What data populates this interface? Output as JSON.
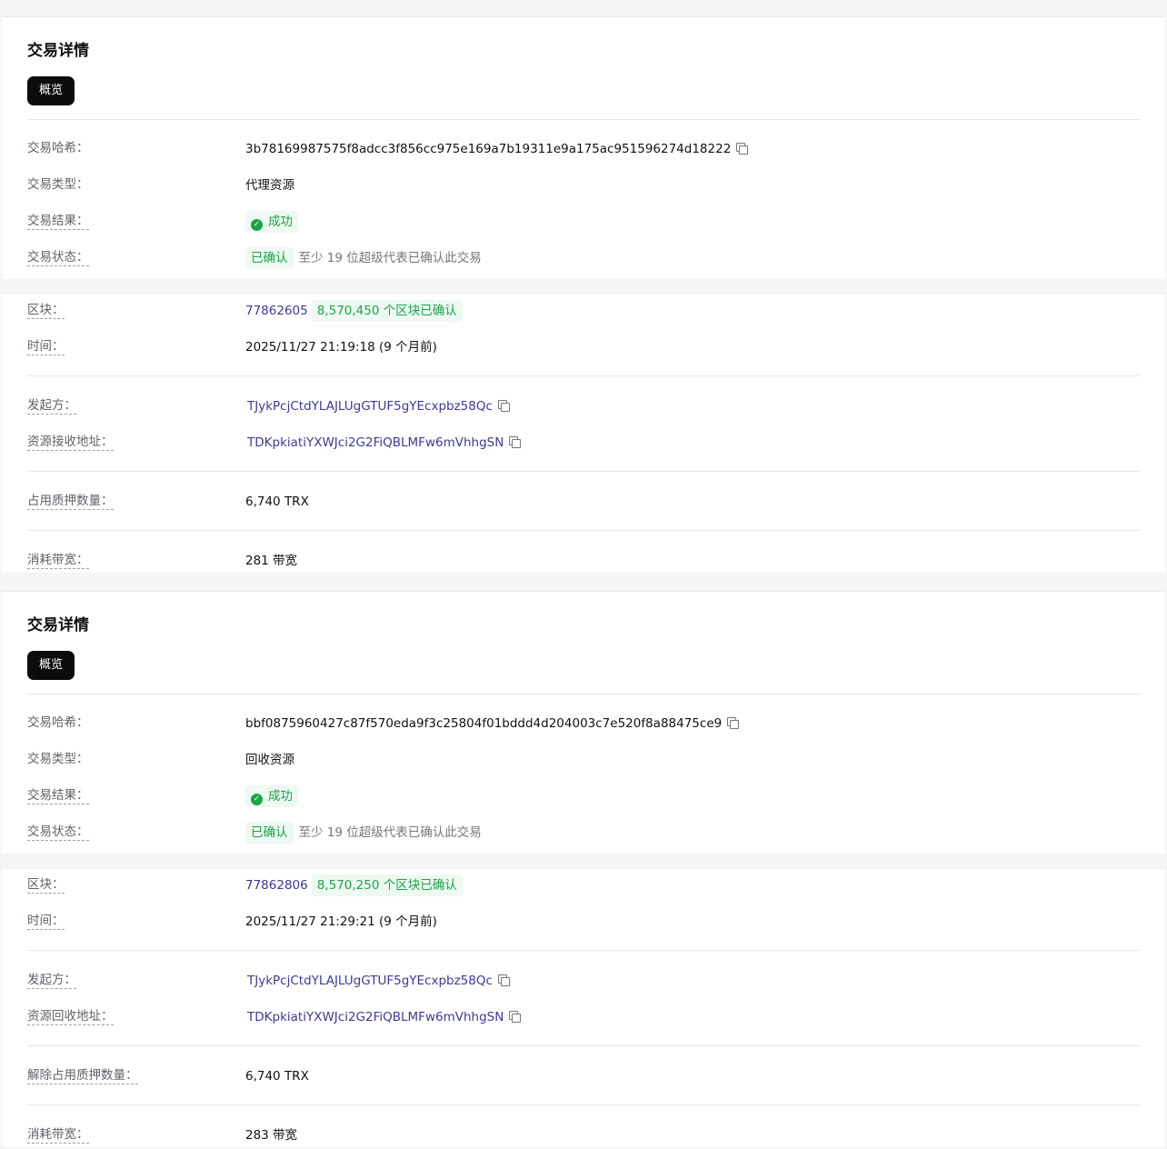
{
  "tx1": {
    "title": "交易详情",
    "tab": "概览",
    "hash_label": "交易哈希：",
    "hash": "3b78169987575f8adcc3f856cc975e169a7b19311e9a175ac951596274d18222",
    "type_label": "交易类型：",
    "type": "代理资源",
    "result_label": "交易结果：",
    "result": "成功",
    "status_label": "交易状态：",
    "status": "已确认",
    "status_note": "至少 19 位超级代表已确认此交易",
    "block_label": "区块：",
    "block": "77862605",
    "block_confirm": "8,570,450 个区块已确认",
    "time_label": "时间：",
    "time": "2025/11/27 21:19:18 (9 个月前)",
    "from_label": "发起方：",
    "from": "TJykPcjCtdYLAJLUgGTUF5gYEcxpbz58Qc",
    "to_label": "资源接收地址：",
    "to": "TDKpkiatiYXWJci2G2FiQBLMFw6mVhhgSN",
    "stake_label": "占用质押数量：",
    "stake": "6,740 TRX",
    "bandwidth_label": "消耗带宽：",
    "bandwidth": "281 带宽"
  },
  "tx2": {
    "title": "交易详情",
    "tab": "概览",
    "hash_label": "交易哈希：",
    "hash": "bbf0875960427c87f570eda9f3c25804f01bddd4d204003c7e520f8a88475ce9",
    "type_label": "交易类型：",
    "type": "回收资源",
    "result_label": "交易结果：",
    "result": "成功",
    "status_label": "交易状态：",
    "status": "已确认",
    "status_note": "至少 19 位超级代表已确认此交易",
    "block_label": "区块：",
    "block": "77862806",
    "block_confirm": "8,570,250 个区块已确认",
    "time_label": "时间：",
    "time": "2025/11/27 21:29:21 (9 个月前)",
    "from_label": "发起方：",
    "from": "TJykPcjCtdYLAJLUgGTUF5gYEcxpbz58Qc",
    "to_label": "资源回收地址：",
    "to": "TDKpkiatiYXWJci2G2FiQBLMFw6mVhhgSN",
    "stake_label": "解除占用质押数量：",
    "stake": "6,740 TRX",
    "bandwidth_label": "消耗带宽：",
    "bandwidth": "283 带宽"
  },
  "colors": {
    "link": "#3a3a9c",
    "success": "#1aa34a",
    "label": "#5f6368"
  }
}
